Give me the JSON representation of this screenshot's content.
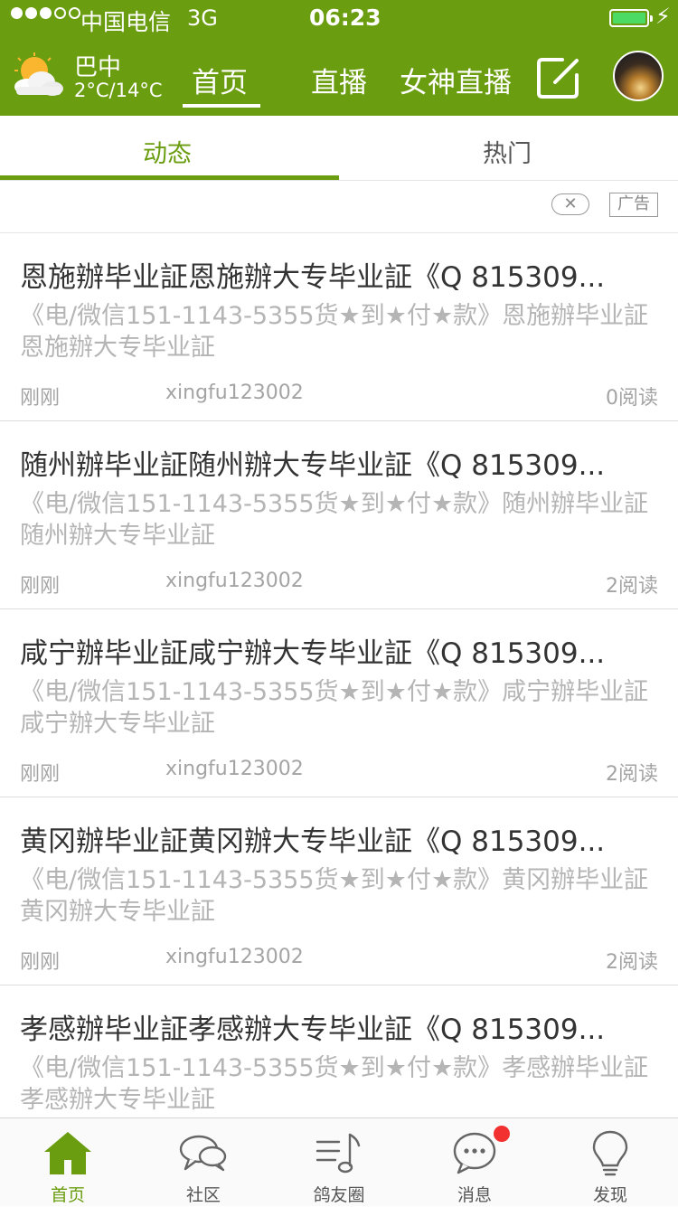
{
  "status_bar": {
    "carrier": "中国电信",
    "network": "3G",
    "time": "06:23",
    "signal_bars_filled": 3,
    "signal_bars_total": 5,
    "battery_level": 1.0,
    "battery_color": "#4cd964"
  },
  "header": {
    "background_color": "#6a9d0f",
    "weather": {
      "icon": "partly-cloudy-icon",
      "city": "巴中",
      "temperature": "2°C/14°C"
    },
    "tabs": [
      {
        "label": "首页",
        "active": true
      },
      {
        "label": "直播",
        "active": false
      },
      {
        "label": "女神直播",
        "active": false
      }
    ],
    "compose_icon": "compose-icon",
    "avatar_icon": "avatar"
  },
  "sub_tabs": [
    {
      "label": "动态",
      "active": true
    },
    {
      "label": "热门",
      "active": false
    }
  ],
  "ad": {
    "close_glyph": "✕",
    "badge": "广告"
  },
  "posts": [
    {
      "title": "恩施辦毕业証恩施辦大专毕业証《Q 815309...",
      "summary": "《电/微信151-1143-5355货★到★付★款》恩施辦毕业証恩施辦大专毕业証",
      "time": "刚刚",
      "author": "xingfu123002",
      "reads": "0阅读"
    },
    {
      "title": "随州辦毕业証随州辦大专毕业証《Q 815309...",
      "summary": "《电/微信151-1143-5355货★到★付★款》随州辦毕业証随州辦大专毕业証",
      "time": "刚刚",
      "author": "xingfu123002",
      "reads": "2阅读"
    },
    {
      "title": "咸宁辦毕业証咸宁辦大专毕业証《Q 815309...",
      "summary": "《电/微信151-1143-5355货★到★付★款》咸宁辦毕业証咸宁辦大专毕业証",
      "time": "刚刚",
      "author": "xingfu123002",
      "reads": "2阅读"
    },
    {
      "title": "黄冈辦毕业証黄冈辦大专毕业証《Q 815309...",
      "summary": "《电/微信151-1143-5355货★到★付★款》黄冈辦毕业証黄冈辦大专毕业証",
      "time": "刚刚",
      "author": "xingfu123002",
      "reads": "2阅读"
    },
    {
      "title": "孝感辦毕业証孝感辦大专毕业証《Q 815309...",
      "summary": "《电/微信151-1143-5355货★到★付★款》孝感辦毕业証孝感辦大专毕业証",
      "time": "",
      "author": "",
      "reads": ""
    }
  ],
  "tab_bar": [
    {
      "label": "首页",
      "icon": "home-icon",
      "active": true
    },
    {
      "label": "社区",
      "icon": "chat-bubbles-icon",
      "active": false
    },
    {
      "label": "鸽友圈",
      "icon": "music-list-icon",
      "active": false
    },
    {
      "label": "消息",
      "icon": "message-icon",
      "active": false,
      "badge": true
    },
    {
      "label": "发现",
      "icon": "lightbulb-icon",
      "active": false
    }
  ],
  "colors": {
    "accent": "#6a9d0f",
    "muted_text": "#b5b5b5",
    "badge_red": "#f23030"
  }
}
